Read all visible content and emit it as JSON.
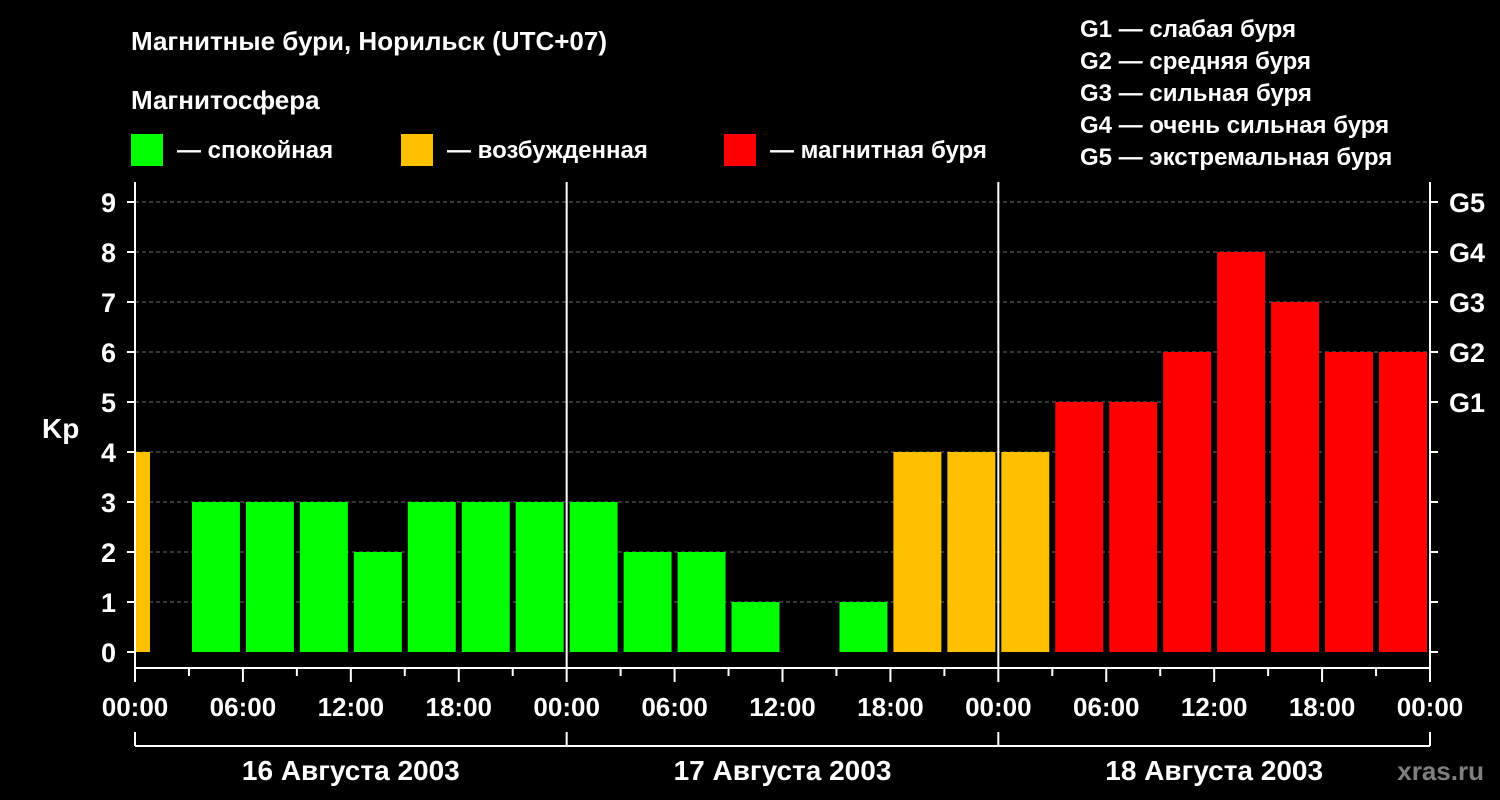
{
  "title": "Магнитные бури, Норильск (UTC+07)",
  "legend": {
    "heading": "Магнитосфера",
    "items": [
      {
        "label": "— спокойная",
        "color": "#00ff00"
      },
      {
        "label": "— возбужденная",
        "color": "#ffc000"
      },
      {
        "label": "— магнитная буря",
        "color": "#ff0000"
      }
    ]
  },
  "g_scale": [
    "G1 — слабая буря",
    "G2 — средняя буря",
    "G3 — сильная буря",
    "G4 — очень сильная буря",
    "G5 — экстремальная буря"
  ],
  "watermark": "xras.ru",
  "chart_data": {
    "type": "bar",
    "ylabel": "Kp",
    "ylim": [
      0,
      9
    ],
    "yticks": [
      "0",
      "1",
      "2",
      "3",
      "4",
      "5",
      "6",
      "7",
      "8",
      "9"
    ],
    "right_ticks": [
      {
        "value": 5,
        "label": "G1"
      },
      {
        "value": 6,
        "label": "G2"
      },
      {
        "value": 7,
        "label": "G3"
      },
      {
        "value": 8,
        "label": "G4"
      },
      {
        "value": 9,
        "label": "G5"
      }
    ],
    "xticks": [
      "00:00",
      "06:00",
      "12:00",
      "18:00",
      "00:00",
      "06:00",
      "12:00",
      "18:00",
      "00:00",
      "06:00",
      "12:00",
      "18:00",
      "00:00"
    ],
    "days": [
      "16 Августа 2003",
      "17 Августа 2003",
      "18 Августа 2003"
    ],
    "bar_hours": 3,
    "values": [
      4,
      3,
      3,
      3,
      2,
      3,
      3,
      3,
      3,
      2,
      2,
      1,
      0,
      1,
      4,
      4,
      4,
      5,
      5,
      6,
      8,
      7,
      6,
      6
    ],
    "colors": {
      "calm": "#00ff00",
      "active": "#ffc000",
      "storm": "#ff0000"
    },
    "grid": true
  }
}
